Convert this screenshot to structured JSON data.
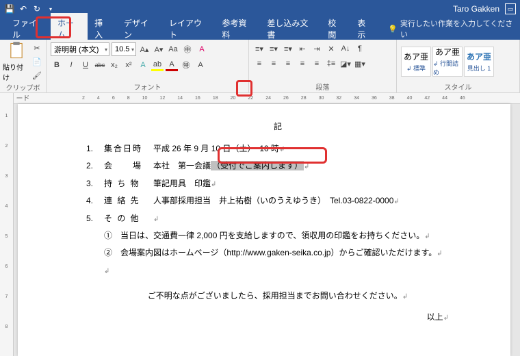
{
  "titlebar": {
    "user": "Taro Gakken"
  },
  "tabs": [
    "ファイル",
    "ホーム",
    "挿入",
    "デザイン",
    "レイアウト",
    "参考資料",
    "差し込み文書",
    "校閲",
    "表示"
  ],
  "active_tab": 1,
  "tellme": "実行したい作業を入力してください",
  "clipboard": {
    "paste": "貼り付け",
    "group": "クリップボード"
  },
  "font": {
    "name": "游明朝 (本文)",
    "size": "10.5",
    "group": "フォント",
    "btns": [
      "B",
      "I",
      "U",
      "abc",
      "x₂",
      "x²"
    ]
  },
  "para": {
    "group": "段落"
  },
  "styles": {
    "group": "スタイル",
    "items": [
      {
        "sample": "あア亜",
        "name": "↲ 標準"
      },
      {
        "sample": "あア亜",
        "name": "↲ 行間詰め"
      },
      {
        "sample": "あア亜",
        "name": "見出し 1"
      }
    ]
  },
  "ruler_marks": [
    "2",
    "4",
    "6",
    "8",
    "10",
    "12",
    "14",
    "16",
    "18",
    "20",
    "22",
    "24",
    "26",
    "28",
    "30",
    "32",
    "34",
    "36",
    "38",
    "40",
    "42",
    "44",
    "46"
  ],
  "vruler": [
    "",
    "1",
    "",
    "2",
    "",
    "3",
    "",
    "4",
    "",
    "5",
    "",
    "6",
    "",
    "7",
    "",
    "8",
    ""
  ],
  "doc": {
    "heading": "記",
    "items": [
      {
        "n": "1.",
        "label": "集合日時",
        "value_pre": "平成 26 年 9 月 10 日（土）　10 時"
      },
      {
        "n": "2.",
        "label": "会　　場",
        "value_pre": "本社　第一会議",
        "selected": "（受付でご案内します）"
      },
      {
        "n": "3.",
        "label": "持 ち 物",
        "value_pre": "筆記用具　印鑑"
      },
      {
        "n": "4.",
        "label": "連 絡 先",
        "value_pre": "人事部採用担当　井上祐樹（いのうえゆうき）　Tel.03-0822-0000"
      },
      {
        "n": "5.",
        "label": "そ の 他",
        "value_pre": ""
      }
    ],
    "sub1": "①　当日は、交通費一律 2,000 円を支給しますので、領収用の印鑑をお持ちください。",
    "sub2": "②　会場案内図はホームページ（http://www.gaken-seika.co.jp）からご確認いただけます。",
    "closing": "ご不明な点がございましたら、採用担当までお問い合わせください。",
    "ijo": "以上"
  }
}
